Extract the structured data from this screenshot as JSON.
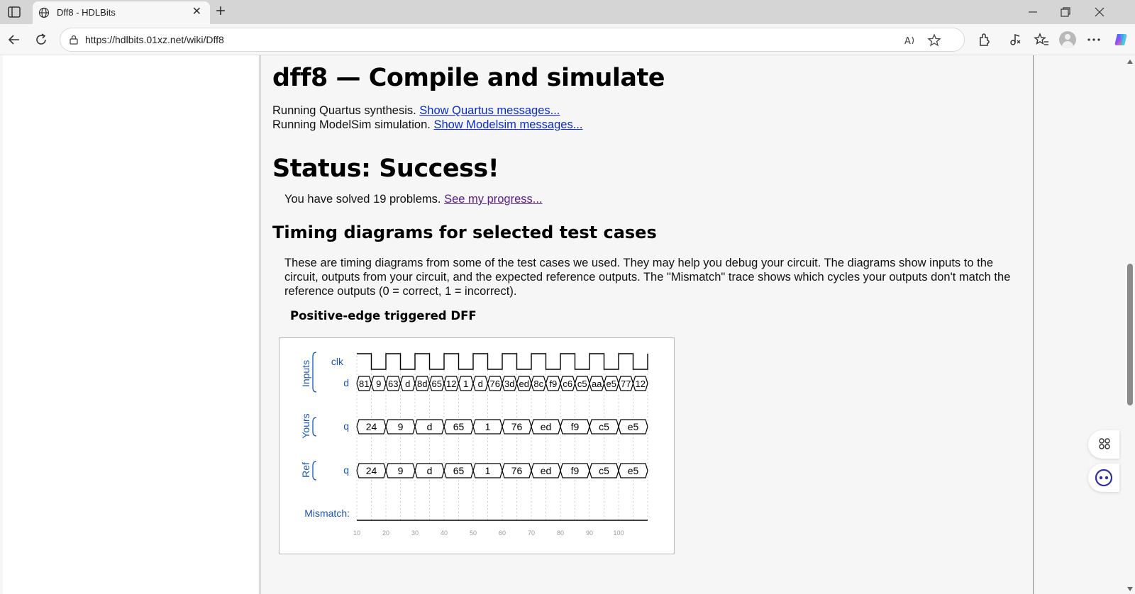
{
  "browser": {
    "tab_title": "Dff8 - HDLBits",
    "url": "https://hdlbits.01xz.net/wiki/Dff8",
    "icons": [
      "tab-actions-icon",
      "globe-icon",
      "close-icon",
      "plus-icon",
      "minimize-icon",
      "restore-icon",
      "close-window-icon",
      "back-icon",
      "refresh-icon",
      "lock-icon",
      "read-aloud-icon",
      "favorite-star-icon",
      "extensions-icon",
      "media-icon",
      "favorites-icon",
      "profile-icon",
      "more-icon",
      "copilot-icon"
    ]
  },
  "page": {
    "title": "dff8 — Compile and simulate",
    "quartus_text": "Running Quartus synthesis.",
    "quartus_link": "Show Quartus messages...",
    "modelsim_text": "Running ModelSim simulation.",
    "modelsim_link": "Show Modelsim messages...",
    "status": "Status: Success!",
    "solved_text": "You have solved 19 problems.",
    "progress_link": "See my progress...",
    "timing_heading": "Timing diagrams for selected test cases",
    "timing_description": "These are timing diagrams from some of the test cases we used. They may help you debug your circuit. The diagrams show inputs to the circuit, outputs from your circuit, and the expected reference outputs. The \"Mismatch\" trace shows which cycles your outputs don't match the reference outputs (0 = correct, 1 = incorrect).",
    "waveform_caption": "Positive-edge triggered DFF"
  },
  "waveform": {
    "groups": [
      "Inputs",
      "Yours",
      "Ref"
    ],
    "signals": {
      "clk": "clk",
      "d": "d",
      "q_yours": "q",
      "q_ref": "q",
      "mismatch": "Mismatch:"
    },
    "d_values": [
      "81",
      "9",
      "63",
      "d",
      "8d",
      "65",
      "12",
      "1",
      "d",
      "76",
      "3d",
      "ed",
      "8c",
      "f9",
      "c6",
      "c5",
      "aa",
      "e5",
      "77",
      "12"
    ],
    "q_values": [
      "24",
      "9",
      "d",
      "65",
      "1",
      "76",
      "ed",
      "f9",
      "c5",
      "e5"
    ],
    "ref_values": [
      "24",
      "9",
      "d",
      "65",
      "1",
      "76",
      "ed",
      "f9",
      "c5",
      "e5"
    ],
    "time_ticks": [
      "10",
      "20",
      "30",
      "40",
      "50",
      "60",
      "70",
      "80",
      "90",
      "100"
    ],
    "mismatch_count": 0,
    "colors": {
      "label": "#1a55b4",
      "trace": "#000000",
      "grid": "#cfcfcf"
    }
  }
}
